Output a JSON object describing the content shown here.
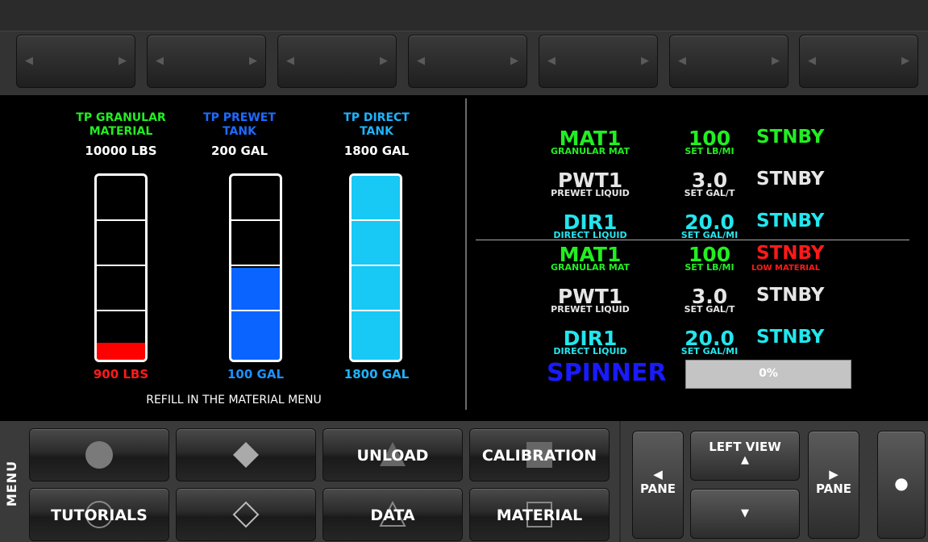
{
  "tabs": [
    "",
    "",
    "",
    "",
    "",
    "",
    ""
  ],
  "tanks": [
    {
      "title": "TP GRANULAR MATERIAL",
      "title_l1": "TP GRANULAR",
      "title_l2": "MATERIAL",
      "title_color": "#22ee22",
      "capacity": "10000 LBS",
      "level": "900 LBS",
      "level_color": "#ff1a1a",
      "fill_fraction": 0.09,
      "fill_color": "#ff0000"
    },
    {
      "title": "TP PREWET TANK",
      "title_l1": "TP PREWET",
      "title_l2": "TANK",
      "title_color": "#1e6bff",
      "capacity": "200 GAL",
      "level": "100 GAL",
      "level_color": "#1e90ff",
      "fill_fraction": 0.5,
      "fill_color": "#0a64ff"
    },
    {
      "title": "TP DIRECT TANK",
      "title_l1": "TP DIRECT",
      "title_l2": "TANK",
      "title_color": "#1eb4ff",
      "capacity": "1800 GAL",
      "level": "1800 GAL",
      "level_color": "#1eb4ff",
      "fill_fraction": 1.0,
      "fill_color": "#18c8f5"
    }
  ],
  "refill_note": "REFILL IN THE MATERIAL MENU",
  "rates_top": [
    {
      "name": "MAT1",
      "sub": "GRANULAR MAT",
      "value": "100",
      "unit": "SET LB/MI",
      "status": "STNBY",
      "status_sub": "",
      "color": "#22ee22",
      "status_color": "#22ee22"
    },
    {
      "name": "PWT1",
      "sub": "PREWET LIQUID",
      "value": "3.0",
      "unit": "SET GAL/T",
      "status": "STNBY",
      "status_sub": "",
      "color": "#e6e6e6",
      "status_color": "#e6e6e6"
    },
    {
      "name": "DIR1",
      "sub": "DIRECT LIQUID",
      "value": "20.0",
      "unit": "SET GAL/MI",
      "status": "STNBY",
      "status_sub": "",
      "color": "#22e6ee",
      "status_color": "#22e6ee"
    }
  ],
  "rates_bottom": [
    {
      "name": "MAT1",
      "sub": "GRANULAR MAT",
      "value": "100",
      "unit": "SET LB/MI",
      "status": "STNBY",
      "status_sub": "LOW MATERIAL",
      "color": "#22ee22",
      "status_color": "#ff1a1a"
    },
    {
      "name": "PWT1",
      "sub": "PREWET LIQUID",
      "value": "3.0",
      "unit": "SET GAL/T",
      "status": "STNBY",
      "status_sub": "",
      "color": "#e6e6e6",
      "status_color": "#e6e6e6"
    },
    {
      "name": "DIR1",
      "sub": "DIRECT LIQUID",
      "value": "20.0",
      "unit": "SET GAL/MI",
      "status": "STNBY",
      "status_sub": "",
      "color": "#22e6ee",
      "status_color": "#22e6ee"
    }
  ],
  "spinner": {
    "label": "SPINNER",
    "percent_text": "0%",
    "percent": 0
  },
  "menu": {
    "label": "MENU",
    "buttons": [
      "",
      "",
      "UNLOAD",
      "CALIBRATION",
      "TUTORIALS",
      "",
      "DATA",
      "MATERIAL"
    ],
    "icons": [
      "circle-icon",
      "diamond-icon",
      "triangle-icon",
      "square-icon",
      "circle-outline-icon",
      "diamond-outline-icon",
      "triangle-outline-icon",
      "square-outline-icon"
    ]
  },
  "nav": {
    "pane_left": "PANE",
    "left_view": "LEFT VIEW",
    "pane_right": "PANE"
  }
}
